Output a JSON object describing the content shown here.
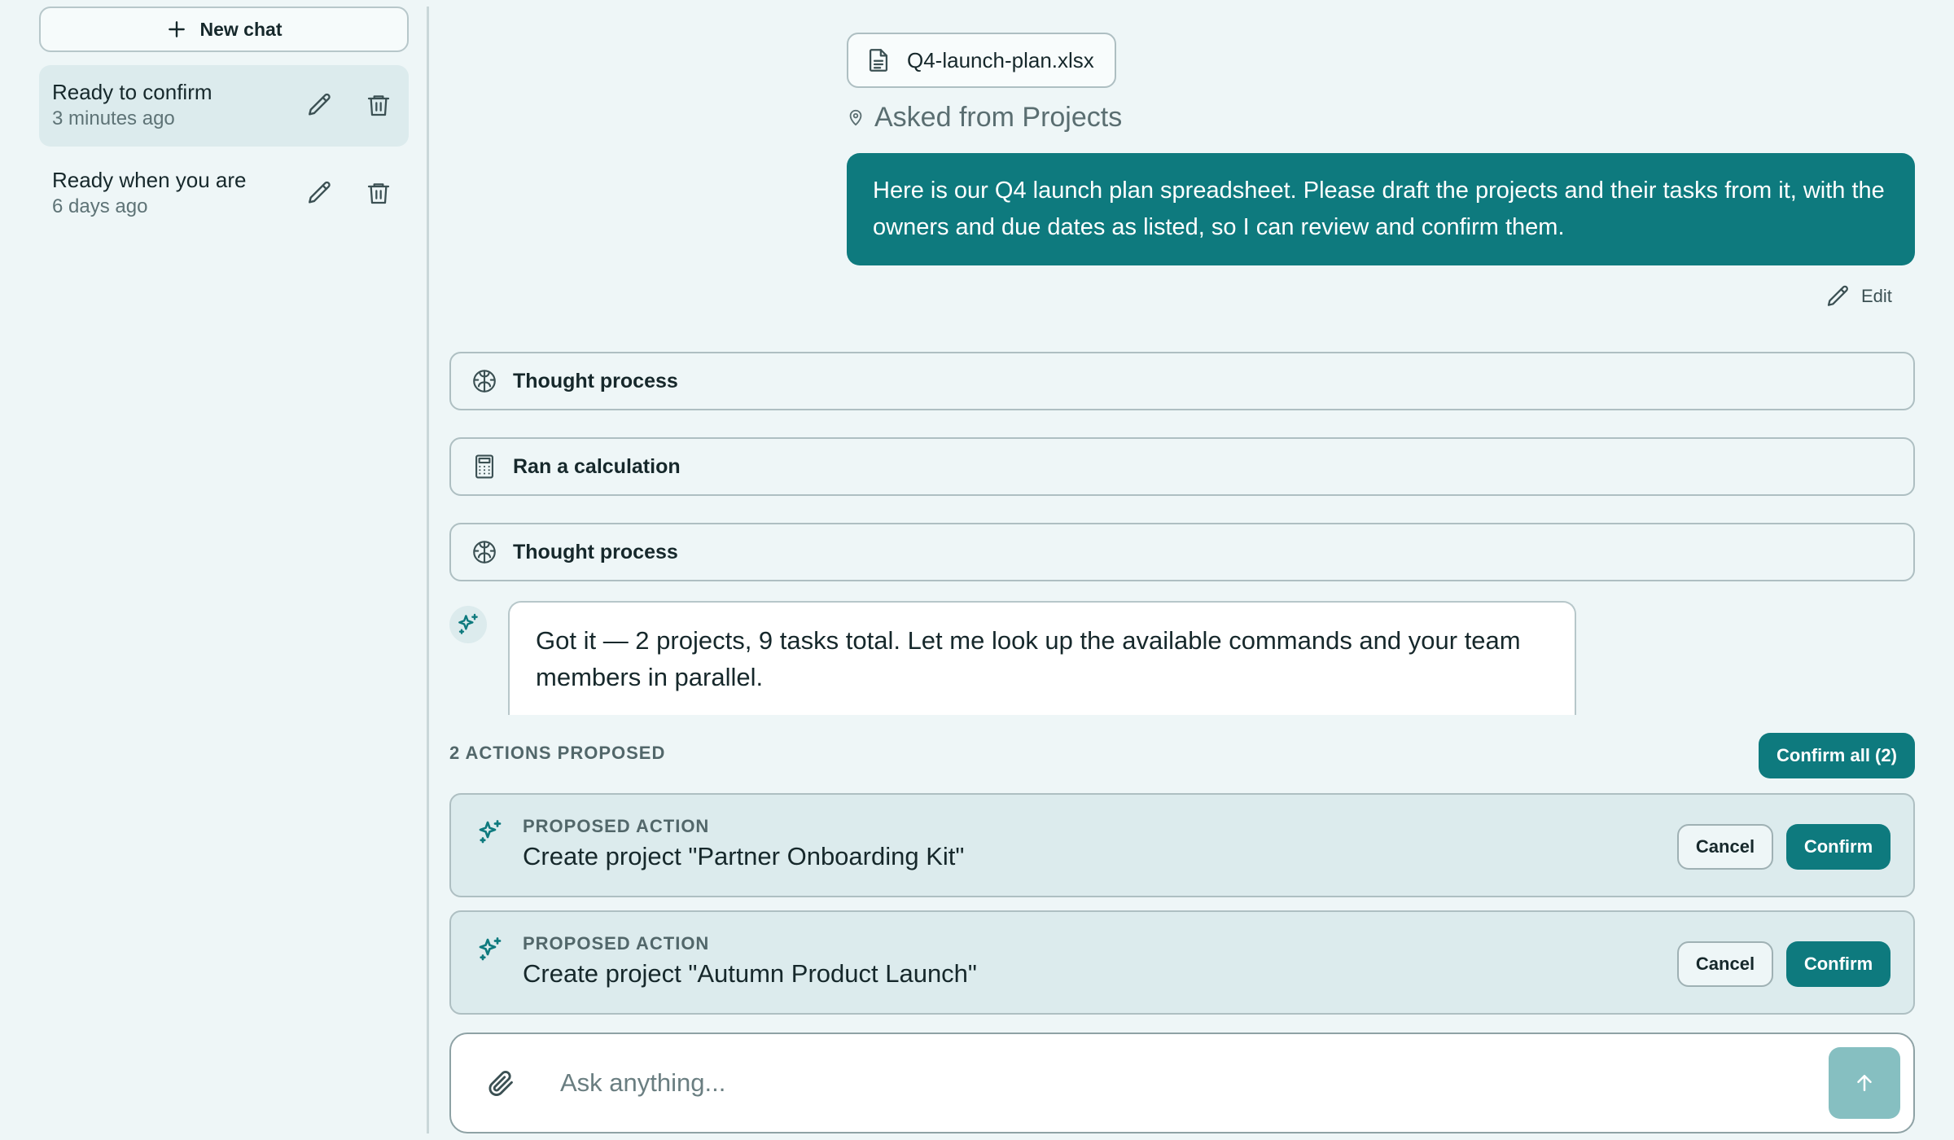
{
  "sidebar": {
    "new_chat_label": "New chat",
    "chats": [
      {
        "title": "Ready to confirm",
        "time": "3 minutes ago",
        "active": true
      },
      {
        "title": "Ready when you are",
        "time": "6 days ago",
        "active": false
      }
    ]
  },
  "conversation": {
    "attachment": {
      "filename": "Q4-launch-plan.xlsx",
      "icon": "file-icon"
    },
    "asked_from": "Asked from Projects",
    "user_message": "Here is our Q4 launch plan spreadsheet. Please draft the projects and their tasks from it, with the owners and due dates as listed, so I can review and confirm them.",
    "edit_label": "Edit",
    "steps": [
      {
        "label": "Thought process",
        "icon": "brain-icon"
      },
      {
        "label": "Ran a calculation",
        "icon": "calculator-icon"
      },
      {
        "label": "Thought process",
        "icon": "brain-icon"
      }
    ],
    "assistant_message": "Got it — 2 projects, 9 tasks total. Let me look up the available commands and your team members in parallel."
  },
  "actions": {
    "header": "2 ACTIONS PROPOSED",
    "confirm_all_label": "Confirm all (2)",
    "items": [
      {
        "kicker": "PROPOSED ACTION",
        "title": "Create project \"Partner Onboarding Kit\"",
        "cancel_label": "Cancel",
        "confirm_label": "Confirm"
      },
      {
        "kicker": "PROPOSED ACTION",
        "title": "Create project \"Autumn Product Launch\"",
        "cancel_label": "Cancel",
        "confirm_label": "Confirm"
      }
    ]
  },
  "composer": {
    "placeholder": "Ask anything...",
    "value": ""
  },
  "colors": {
    "accent": "#0e7a7e",
    "background": "#eef6f7",
    "card": "#dcebed",
    "send_disabled": "#86bfc1"
  }
}
